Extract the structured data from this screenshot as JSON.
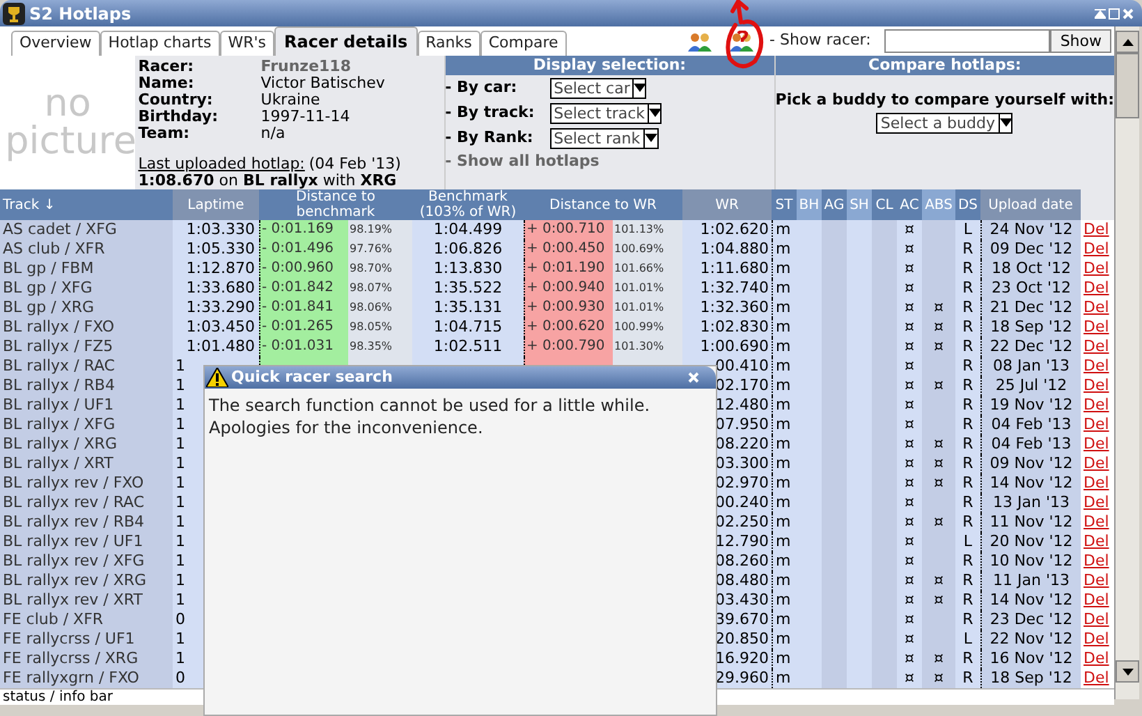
{
  "window": {
    "title": "S2 Hotlaps"
  },
  "tabs": [
    {
      "label": "Overview",
      "selected": false
    },
    {
      "label": "Hotlap charts",
      "selected": false
    },
    {
      "label": "WR's",
      "selected": false
    },
    {
      "label": "Racer details",
      "selected": true
    },
    {
      "label": "Ranks",
      "selected": false
    },
    {
      "label": "Compare",
      "selected": false
    }
  ],
  "show_racer": {
    "label": "- Show racer:",
    "button": "Show"
  },
  "avatar": {
    "text": "no picture"
  },
  "racer": [
    {
      "label": "Racer:",
      "value": "Frunze118"
    },
    {
      "label": "Name:",
      "value": "Victor Batischev"
    },
    {
      "label": "Country:",
      "value": "Ukraine"
    },
    {
      "label": "Birthday:",
      "value": "1997-11-14"
    },
    {
      "label": "Team:",
      "value": "n/a"
    }
  ],
  "last_upload": {
    "link": "Last uploaded hotlap:",
    "date": "(04 Feb '13)",
    "detail": "**1:08.670** on **BL rallyx** with **XRG**"
  },
  "display_selection": {
    "title": "Display selection:",
    "filters": [
      {
        "label": "- By car:",
        "select": "Select car"
      },
      {
        "label": "- By track:",
        "select": "Select track"
      },
      {
        "label": "- By Rank:",
        "select": "Select rank"
      }
    ],
    "show_all": "- Show all hotlaps"
  },
  "compare": {
    "title": "Compare hotlaps:",
    "text": "Pick a buddy to compare yourself with:",
    "select": "Select a buddy"
  },
  "table": {
    "columns": [
      {
        "label": "Track ↓"
      },
      {
        "label": "Laptime"
      },
      {
        "label": "Distance to benchmark",
        "kind": "pair"
      },
      {
        "label": "Benchmark (103% of WR)"
      },
      {
        "label": "Distance to WR",
        "kind": "pair"
      },
      {
        "label": "WR"
      },
      {
        "label": "ST"
      },
      {
        "label": "BH"
      },
      {
        "label": "AG"
      },
      {
        "label": "SH"
      },
      {
        "label": "CL"
      },
      {
        "label": "AC"
      },
      {
        "label": "ABS"
      },
      {
        "label": "DS"
      },
      {
        "label": "Upload date"
      }
    ],
    "rows": [
      {
        "track": "AS cadet / XFG",
        "laptime": "1:03.330",
        "dist_bench": "- 0:01.169",
        "dist_bench_pct": "98.19%",
        "benchmark": "1:04.499",
        "dist_wr": "+ 0:00.710",
        "dist_wr_pct": "101.13%",
        "wr": "1:02.620",
        "st": "m",
        "ac": "¤",
        "ds": "L",
        "date": "24 Nov '12",
        "action": "Del"
      },
      {
        "track": "AS club / XFR",
        "laptime": "1:05.330",
        "dist_bench": "- 0:01.496",
        "dist_bench_pct": "97.76%",
        "benchmark": "1:06.826",
        "dist_wr": "+ 0:00.450",
        "dist_wr_pct": "100.69%",
        "wr": "1:04.880",
        "st": "m",
        "ac": "¤",
        "ds": "R",
        "date": "09 Dec '12",
        "action": "Del"
      },
      {
        "track": "BL gp / FBM",
        "laptime": "1:12.870",
        "dist_bench": "- 0:00.960",
        "dist_bench_pct": "98.70%",
        "benchmark": "1:13.830",
        "dist_wr": "+ 0:01.190",
        "dist_wr_pct": "101.66%",
        "wr": "1:11.680",
        "st": "m",
        "ac": "¤",
        "ds": "R",
        "date": "18 Oct '12",
        "action": "Del"
      },
      {
        "track": "BL gp / XFG",
        "laptime": "1:33.680",
        "dist_bench": "- 0:01.842",
        "dist_bench_pct": "98.07%",
        "benchmark": "1:35.522",
        "dist_wr": "+ 0:00.940",
        "dist_wr_pct": "101.01%",
        "wr": "1:32.740",
        "st": "m",
        "ac": "¤",
        "ds": "R",
        "date": "23 Oct '12",
        "action": "Del"
      },
      {
        "track": "BL gp / XRG",
        "laptime": "1:33.290",
        "dist_bench": "- 0:01.841",
        "dist_bench_pct": "98.06%",
        "benchmark": "1:35.131",
        "dist_wr": "+ 0:00.930",
        "dist_wr_pct": "101.01%",
        "wr": "1:32.360",
        "st": "m",
        "ac": "¤",
        "abs": "¤",
        "ds": "R",
        "date": "21 Dec '12",
        "action": "Del"
      },
      {
        "track": "BL rallyx / FXO",
        "laptime": "1:03.450",
        "dist_bench": "- 0:01.265",
        "dist_bench_pct": "98.05%",
        "benchmark": "1:04.715",
        "dist_wr": "+ 0:00.620",
        "dist_wr_pct": "100.99%",
        "wr": "1:02.830",
        "st": "m",
        "ac": "¤",
        "abs": "¤",
        "ds": "R",
        "date": "18 Sep '12",
        "action": "Del"
      },
      {
        "track": "BL rallyx / FZ5",
        "laptime": "1:01.480",
        "dist_bench": "- 0:01.031",
        "dist_bench_pct": "98.35%",
        "benchmark": "1:02.511",
        "dist_wr": "+ 0:00.790",
        "dist_wr_pct": "101.30%",
        "wr": "1:00.690",
        "st": "m",
        "ac": "¤",
        "abs": "¤",
        "ds": "R",
        "date": "22 Dec '12",
        "action": "Del"
      },
      {
        "track": "BL rallyx / RAC",
        "laptime": "1",
        "wr": "00.410",
        "st": "m",
        "ac": "¤",
        "ds": "R",
        "date": "08 Jan '13",
        "action": "Del"
      },
      {
        "track": "BL rallyx / RB4",
        "laptime": "1",
        "wr": "02.170",
        "st": "m",
        "ac": "¤",
        "abs": "¤",
        "ds": "R",
        "date": "25 Jul '12",
        "action": "Del"
      },
      {
        "track": "BL rallyx / UF1",
        "laptime": "1",
        "wr": "12.480",
        "st": "m",
        "ac": "¤",
        "ds": "R",
        "date": "19 Nov '12",
        "action": "Del"
      },
      {
        "track": "BL rallyx / XFG",
        "laptime": "1",
        "wr": "07.950",
        "st": "m",
        "ac": "¤",
        "ds": "R",
        "date": "04 Feb '13",
        "action": "Del"
      },
      {
        "track": "BL rallyx / XRG",
        "laptime": "1",
        "wr": "08.220",
        "st": "m",
        "ac": "¤",
        "abs": "¤",
        "ds": "R",
        "date": "04 Feb '13",
        "action": "Del"
      },
      {
        "track": "BL rallyx / XRT",
        "laptime": "1",
        "wr": "03.300",
        "st": "m",
        "ac": "¤",
        "abs": "¤",
        "ds": "R",
        "date": "09 Nov '12",
        "action": "Del"
      },
      {
        "track": "BL rallyx rev / FXO",
        "laptime": "1",
        "wr": "02.970",
        "st": "m",
        "ac": "¤",
        "abs": "¤",
        "ds": "R",
        "date": "14 Nov '12",
        "action": "Del"
      },
      {
        "track": "BL rallyx rev / RAC",
        "laptime": "1",
        "wr": "00.240",
        "st": "m",
        "ac": "¤",
        "ds": "R",
        "date": "13 Jan '13",
        "action": "Del"
      },
      {
        "track": "BL rallyx rev / RB4",
        "laptime": "1",
        "wr": "02.250",
        "st": "m",
        "ac": "¤",
        "abs": "¤",
        "ds": "R",
        "date": "11 Nov '12",
        "action": "Del"
      },
      {
        "track": "BL rallyx rev / UF1",
        "laptime": "1",
        "wr": "12.790",
        "st": "m",
        "ac": "¤",
        "ds": "L",
        "date": "20 Nov '12",
        "action": "Del"
      },
      {
        "track": "BL rallyx rev / XFG",
        "laptime": "1",
        "wr": "08.260",
        "st": "m",
        "ac": "¤",
        "ds": "R",
        "date": "10 Nov '12",
        "action": "Del"
      },
      {
        "track": "BL rallyx rev / XRG",
        "laptime": "1",
        "wr": "08.480",
        "st": "m",
        "ac": "¤",
        "abs": "¤",
        "ds": "R",
        "date": "11 Jan '13",
        "action": "Del"
      },
      {
        "track": "BL rallyx rev / XRT",
        "laptime": "1",
        "wr": "03.430",
        "st": "m",
        "ac": "¤",
        "abs": "¤",
        "ds": "R",
        "date": "14 Nov '12",
        "action": "Del"
      },
      {
        "track": "FE club / XFR",
        "laptime": "0",
        "wr": "39.670",
        "st": "m",
        "ac": "¤",
        "ds": "R",
        "date": "23 Dec '12",
        "action": "Del"
      },
      {
        "track": "FE rallycrss / UF1",
        "laptime": "1",
        "wr": "20.850",
        "st": "m",
        "ac": "¤",
        "ds": "L",
        "date": "22 Nov '12",
        "action": "Del"
      },
      {
        "track": "FE rallycrss / XRG",
        "laptime": "1",
        "wr": "16.920",
        "st": "m",
        "ac": "¤",
        "abs": "¤",
        "ds": "R",
        "date": "16 Nov '12",
        "action": "Del"
      },
      {
        "track": "FE rallyxgrn / FXO",
        "laptime": "0",
        "wr": "29.960",
        "st": "m",
        "ac": "¤",
        "abs": "¤",
        "ds": "R",
        "date": "18 Sep '12",
        "action": "Del"
      }
    ]
  },
  "status_bar": {
    "text": "status / info bar"
  },
  "popup": {
    "title": "Quick racer search",
    "lines": [
      "The search function cannot be used for a little while.",
      "Apologies for the inconvenience."
    ]
  }
}
